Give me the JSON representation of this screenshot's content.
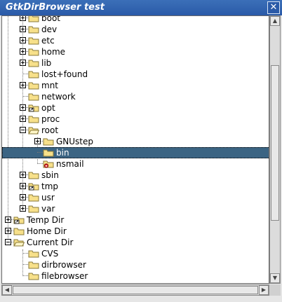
{
  "window": {
    "title": "GtkDirBrowser test",
    "close_glyph": "✕"
  },
  "tree": {
    "rows": [
      {
        "label": "boot",
        "depth": 1,
        "expander": "plus",
        "icon": "folder-icon"
      },
      {
        "label": "dev",
        "depth": 1,
        "expander": "plus",
        "icon": "folder-icon"
      },
      {
        "label": "etc",
        "depth": 1,
        "expander": "plus",
        "icon": "folder-icon"
      },
      {
        "label": "home",
        "depth": 1,
        "expander": "plus",
        "icon": "folder-icon"
      },
      {
        "label": "lib",
        "depth": 1,
        "expander": "plus",
        "icon": "folder-icon"
      },
      {
        "label": "lost+found",
        "depth": 1,
        "expander": "none",
        "icon": "folder-icon"
      },
      {
        "label": "mnt",
        "depth": 1,
        "expander": "plus",
        "icon": "folder-icon"
      },
      {
        "label": "network",
        "depth": 1,
        "expander": "none",
        "icon": "folder-icon"
      },
      {
        "label": "opt",
        "depth": 1,
        "expander": "plus",
        "icon": "folder-link-icon"
      },
      {
        "label": "proc",
        "depth": 1,
        "expander": "plus",
        "icon": "folder-icon"
      },
      {
        "label": "root",
        "depth": 1,
        "expander": "minus",
        "icon": "folder-open-icon"
      },
      {
        "label": "GNUstep",
        "depth": 2,
        "expander": "plus",
        "icon": "folder-icon"
      },
      {
        "label": "bin",
        "depth": 2,
        "expander": "none",
        "icon": "folder-icon",
        "selected": true
      },
      {
        "label": "nsmail",
        "depth": 2,
        "expander": "none",
        "icon": "folder-locked-icon"
      },
      {
        "label": "sbin",
        "depth": 1,
        "expander": "plus",
        "icon": "folder-icon"
      },
      {
        "label": "tmp",
        "depth": 1,
        "expander": "plus",
        "icon": "folder-link-icon"
      },
      {
        "label": "usr",
        "depth": 1,
        "expander": "plus",
        "icon": "folder-icon"
      },
      {
        "label": "var",
        "depth": 1,
        "expander": "plus",
        "icon": "folder-icon"
      },
      {
        "label": "Temp Dir",
        "depth": 0,
        "expander": "plus",
        "icon": "folder-link-icon"
      },
      {
        "label": "Home Dir",
        "depth": 0,
        "expander": "plus",
        "icon": "folder-icon"
      },
      {
        "label": "Current Dir",
        "depth": 0,
        "expander": "minus",
        "icon": "folder-open-icon"
      },
      {
        "label": "CVS",
        "depth": 1,
        "expander": "none",
        "icon": "folder-icon"
      },
      {
        "label": "dirbrowser",
        "depth": 1,
        "expander": "none",
        "icon": "folder-icon"
      },
      {
        "label": "filebrowser",
        "depth": 1,
        "expander": "none",
        "icon": "folder-icon"
      }
    ]
  },
  "scrollbars": {
    "up_glyph": "▲",
    "down_glyph": "▼",
    "left_glyph": "◀",
    "right_glyph": "▶"
  },
  "colors": {
    "selection": "#3b6483",
    "titlebar": "#2a5aa8",
    "folder": "#f7e08a",
    "folder_border": "#8a7a3a"
  }
}
